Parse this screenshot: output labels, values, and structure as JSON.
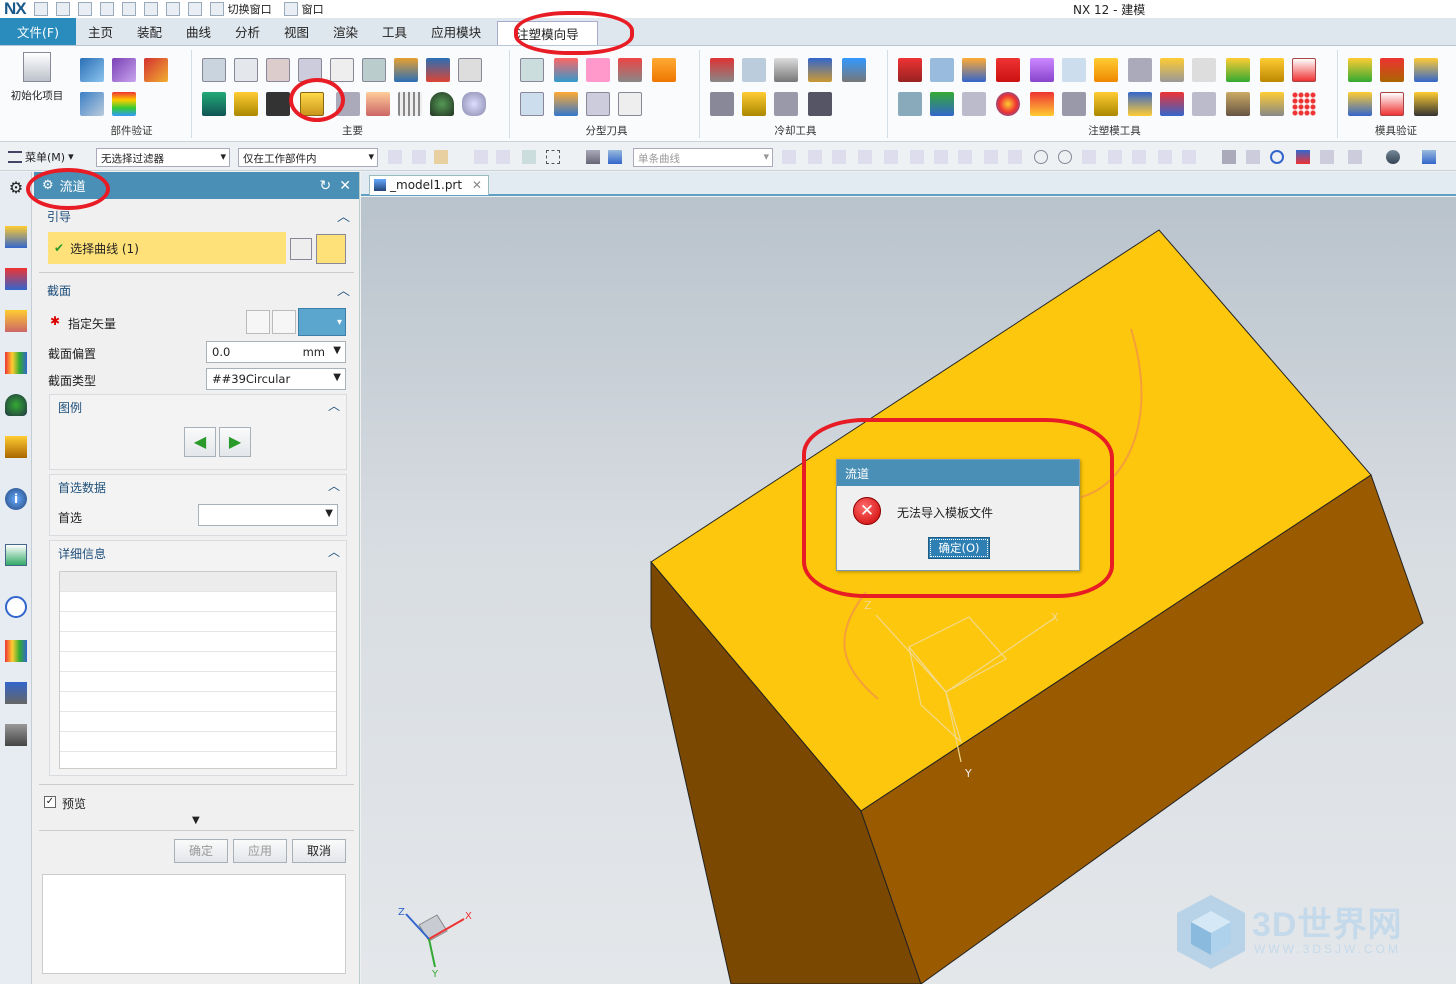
{
  "app": {
    "logo": "NX",
    "title": "NX 12 - 建模",
    "quick_access": {
      "switch_window": "切换窗口",
      "window": "窗口"
    }
  },
  "ribbon": {
    "tabs": [
      "文件(F)",
      "主页",
      "装配",
      "曲线",
      "分析",
      "视图",
      "渲染",
      "工具",
      "应用模块",
      "注塑模向导"
    ],
    "active_tab": "注塑模向导",
    "init_project": "初始化项目",
    "groups": [
      "部件验证",
      "主要",
      "分型刀具",
      "冷却工具",
      "注塑模工具",
      "模具验证"
    ]
  },
  "selection_bar": {
    "menu": "菜单(M)",
    "filter": "无选择过滤器",
    "scope": "仅在工作部件内",
    "curve_rule": "单条曲线"
  },
  "dialog": {
    "title": "流道",
    "guide_section": "引导",
    "select_curve": "选择曲线 (1)",
    "section_section": "截面",
    "specify_vector": "指定矢量",
    "offset_label": "截面偏置",
    "offset_value": "0.0",
    "offset_unit": "mm",
    "type_label": "截面类型",
    "type_value": "##39Circular",
    "legend_section": "图例",
    "pref_section": "首选数据",
    "pref_label": "首选",
    "pref_value": "",
    "detail_section": "详细信息",
    "preview_label": "预览",
    "preview_checked": true,
    "ok": "确定",
    "apply": "应用",
    "cancel": "取消"
  },
  "workspace": {
    "doc_tab": "_model1.prt",
    "axis_labels": {
      "x": "X",
      "y": "Y",
      "z": "Z"
    }
  },
  "error_dialog": {
    "title": "流道",
    "message": "无法导入模板文件",
    "ok": "确定(O)"
  },
  "watermark": {
    "text": "3D世界网",
    "sub": "WWW.3DSJW.COM"
  },
  "colors": {
    "accent": "#4a90b6",
    "block_top": "#fcc70c",
    "block_front": "#9a5a00",
    "block_side": "#7a4800",
    "annotation_red": "#e81c24"
  }
}
